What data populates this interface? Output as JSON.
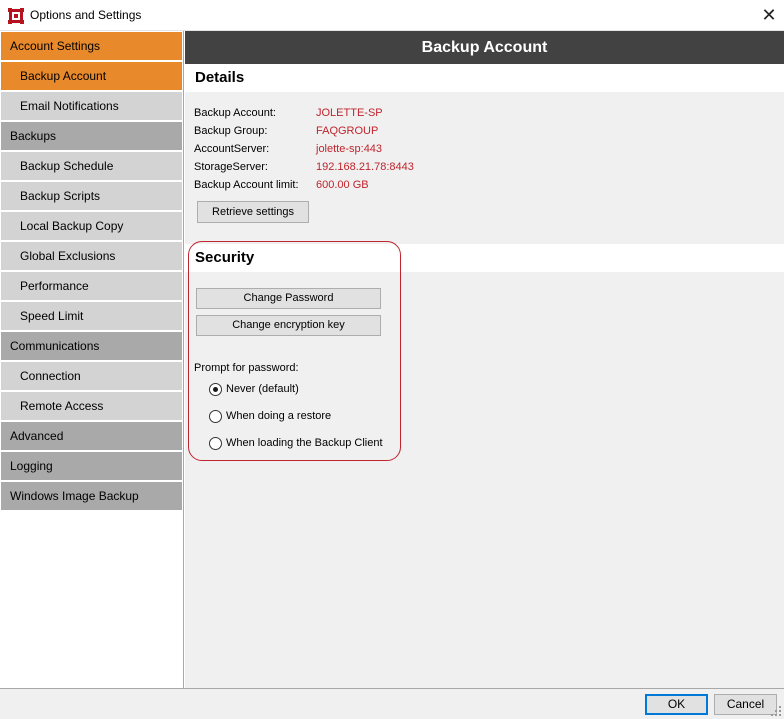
{
  "window": {
    "title": "Options and Settings",
    "close_glyph": "✕",
    "icon": "red-cube-app-icon"
  },
  "sidebar": {
    "items": [
      {
        "label": "Account Settings",
        "level": "group",
        "active": true
      },
      {
        "label": "Backup Account",
        "level": "sub",
        "active": true
      },
      {
        "label": "Email Notifications",
        "level": "sub",
        "active": false
      },
      {
        "label": "Backups",
        "level": "group",
        "active": false
      },
      {
        "label": "Backup Schedule",
        "level": "sub",
        "active": false
      },
      {
        "label": "Backup Scripts",
        "level": "sub",
        "active": false
      },
      {
        "label": "Local Backup Copy",
        "level": "sub",
        "active": false
      },
      {
        "label": "Global Exclusions",
        "level": "sub",
        "active": false
      },
      {
        "label": "Performance",
        "level": "sub",
        "active": false
      },
      {
        "label": "Speed Limit",
        "level": "sub",
        "active": false
      },
      {
        "label": "Communications",
        "level": "group",
        "active": false
      },
      {
        "label": "Connection",
        "level": "sub",
        "active": false
      },
      {
        "label": "Remote Access",
        "level": "sub",
        "active": false
      },
      {
        "label": "Advanced",
        "level": "group",
        "active": false
      },
      {
        "label": "Logging",
        "level": "group",
        "active": false
      },
      {
        "label": "Windows Image Backup",
        "level": "group",
        "active": false
      }
    ]
  },
  "header": {
    "title": "Backup Account"
  },
  "details": {
    "heading": "Details",
    "fields": [
      {
        "label": "Backup Account:",
        "value": "JOLETTE-SP"
      },
      {
        "label": "Backup Group:",
        "value": "FAQGROUP"
      },
      {
        "label": "AccountServer:",
        "value": "jolette-sp:443"
      },
      {
        "label": "StorageServer:",
        "value": "192.168.21.78:8443"
      },
      {
        "label": "Backup Account limit:",
        "value": "600.00 GB"
      }
    ],
    "retrieve_button": "Retrieve settings"
  },
  "security": {
    "heading": "Security",
    "change_password_button": "Change Password",
    "change_key_button": "Change encryption key",
    "prompt_label": "Prompt for password:",
    "options": [
      {
        "label": "Never (default)",
        "selected": true
      },
      {
        "label": "When doing a restore",
        "selected": false
      },
      {
        "label": "When loading the Backup Client",
        "selected": false
      }
    ]
  },
  "footer": {
    "ok_label": "OK",
    "cancel_label": "Cancel"
  },
  "colors": {
    "accent_orange": "#e88a2c",
    "header_dark": "#424242",
    "value_red": "#c0242d",
    "group_gray": "#a9a9a9",
    "sub_gray": "#d3d3d3"
  }
}
